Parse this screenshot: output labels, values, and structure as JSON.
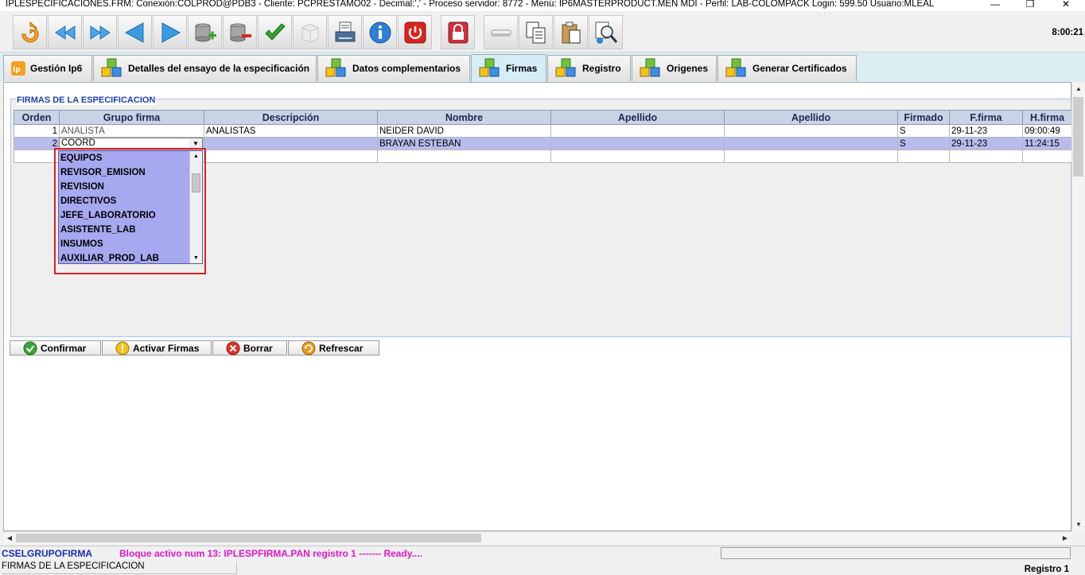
{
  "window": {
    "title": "IPLESPECIFICACIONES.FRM:        Conexión:COLPROD@PDB3 - Cliente: PCPRESTAMO02 - Decimal:',' - Proceso servidor: 8772 - Menú: IP6MASTERPRODUCT.MEN MDI - Perfil: LAB-COLOMPACK Login: 599.50        Usuario:MLEAL",
    "controls": {
      "minimize": "—",
      "restore": "❐",
      "close": "✕"
    }
  },
  "toolbar": {
    "clock": "8:00:21",
    "buttons": [
      {
        "name": "refresh",
        "icon": "refresh-arrow-icon"
      },
      {
        "name": "rewind",
        "icon": "rewind-icon"
      },
      {
        "name": "fast-forward",
        "icon": "fast-forward-icon"
      },
      {
        "name": "previous",
        "icon": "triangle-left-icon"
      },
      {
        "name": "next",
        "icon": "triangle-right-icon"
      },
      {
        "name": "add-record",
        "icon": "database-add-icon"
      },
      {
        "name": "delete-record",
        "icon": "database-remove-icon"
      },
      {
        "name": "accept",
        "icon": "checkmark-icon"
      },
      {
        "name": "box",
        "icon": "box-icon"
      },
      {
        "name": "print",
        "icon": "printer-icon"
      },
      {
        "name": "info",
        "icon": "info-icon"
      },
      {
        "name": "power",
        "icon": "power-icon"
      },
      {
        "name": "lock",
        "icon": "padlock-icon"
      },
      {
        "name": "eraser",
        "icon": "eraser-icon"
      },
      {
        "name": "copy",
        "icon": "copy-icon"
      },
      {
        "name": "paste",
        "icon": "clipboard-icon"
      },
      {
        "name": "zoom",
        "icon": "magnifier-icon"
      }
    ]
  },
  "tabs": [
    {
      "label": "Gestión Ip6",
      "icon": "ip6-logo-icon",
      "active": false
    },
    {
      "label": "Detalles del ensayo de la especificación",
      "icon": "cubes-icon",
      "active": false
    },
    {
      "label": "Datos complementarios",
      "icon": "cubes-icon",
      "active": false
    },
    {
      "label": "Firmas",
      "icon": "cubes-icon",
      "active": true
    },
    {
      "label": "Registro",
      "icon": "cubes-icon",
      "active": false
    },
    {
      "label": "Origenes",
      "icon": "cubes-icon",
      "active": false
    },
    {
      "label": "Generar Certificados",
      "icon": "cubes-icon",
      "active": false
    }
  ],
  "section": {
    "legend": "FIRMAS DE LA ESPECIFICACION"
  },
  "grid": {
    "columns": [
      "Orden",
      "Grupo firma",
      "Descripción",
      "Nombre",
      "Apellido",
      "Apellido",
      "Firmado",
      "F.firma",
      "H.firma"
    ],
    "rows": [
      {
        "orden": "1",
        "grupo": "ANALISTA",
        "descripcion": "ANALISTAS",
        "nombre": "NEIDER DAVID",
        "apellido1": "",
        "apellido2": "",
        "firmado": "S",
        "ffirma": "29-11-23",
        "hfirma": "09:00:49"
      },
      {
        "orden": "2",
        "grupo": "COORD",
        "descripcion": "",
        "nombre": "BRAYAN ESTEBAN",
        "apellido1": "",
        "apellido2": "",
        "firmado": "S",
        "ffirma": "29-11-23",
        "hfirma": "11:24:15"
      }
    ]
  },
  "dropdown": {
    "current_value": "COORD",
    "options": [
      "EQUIPOS",
      "REVISOR_EMISION",
      "REVISION",
      "DIRECTIVOS",
      "JEFE_LABORATORIO",
      "ASISTENTE_LAB",
      "INSUMOS",
      "AUXILIAR_PROD_LAB"
    ]
  },
  "actions": [
    {
      "label": "Confirmar",
      "icon": "green-check-icon",
      "color": "#3aa635"
    },
    {
      "label": "Activar Firmas",
      "icon": "yellow-bulb-icon",
      "color": "#f2c21b"
    },
    {
      "label": "Borrar",
      "icon": "red-x-icon",
      "color": "#e0332b"
    },
    {
      "label": "Refrescar",
      "icon": "orange-refresh-icon",
      "color": "#f29a1b"
    }
  ],
  "status": {
    "block": "CSELGRUPOFIRMA",
    "message": "Bloque activo num 13: IPLESPFIRMA.PAN  registro 1 ------- Ready....",
    "section_label": "FIRMAS DE LA ESPECIFICACION",
    "record": "Registro 1"
  },
  "colors": {
    "status_block": "#1630b8",
    "status_message": "#e317c8",
    "dropdown_bg": "#a6a8f0",
    "selected_row": "#b8bced",
    "highlight_box": "#e01e26"
  }
}
